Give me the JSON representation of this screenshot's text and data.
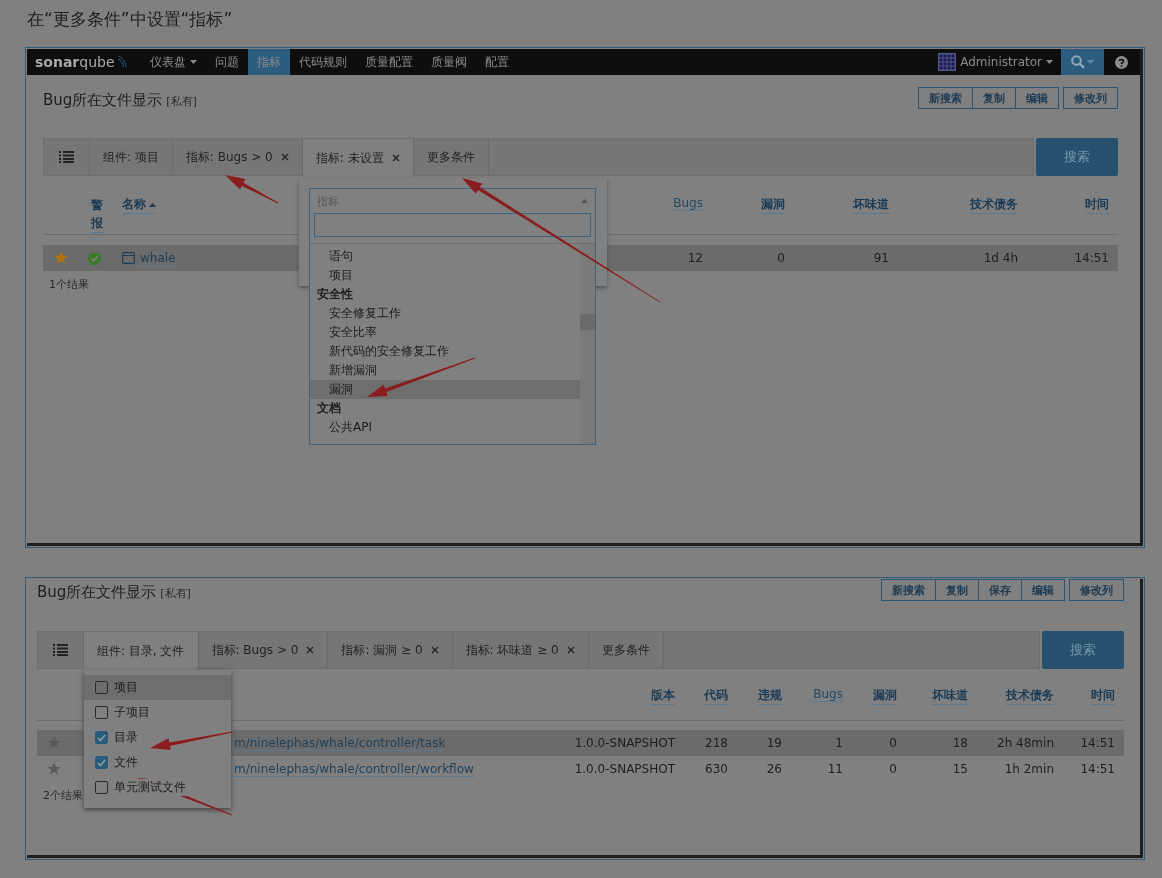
{
  "caption": "在“更多条件”中设置“指标”",
  "shot1": {
    "nav": {
      "logo": "**sonar**qube",
      "items": [
        {
          "label": "仪表盘",
          "dropdown": true,
          "selected": false
        },
        {
          "label": "问题",
          "dropdown": false,
          "selected": false
        },
        {
          "label": "指标",
          "dropdown": false,
          "selected": true
        },
        {
          "label": "代码规则",
          "dropdown": false,
          "selected": false
        },
        {
          "label": "质量配置",
          "dropdown": false,
          "selected": false
        },
        {
          "label": "质量阀",
          "dropdown": false,
          "selected": false
        },
        {
          "label": "配置",
          "dropdown": false,
          "selected": false
        }
      ],
      "user": "Administrator"
    },
    "title": "Bug所在文件显示",
    "visibility": "[私有]",
    "action_groups": [
      [
        "新搜索",
        "复制",
        "编辑"
      ],
      [
        "修改列"
      ]
    ],
    "filters": [
      {
        "label": "组件: 项目",
        "removable": false,
        "selected": false
      },
      {
        "label": "指标: Bugs > 0",
        "removable": true,
        "selected": false
      },
      {
        "label": "指标: 未设置",
        "removable": true,
        "selected": true
      },
      {
        "label": "更多条件",
        "removable": false,
        "selected": false
      }
    ],
    "search_button": "搜索",
    "columns": [
      {
        "label": "警报",
        "highlighted": false
      },
      {
        "label": "名称",
        "sort_ascending": true,
        "highlighted": false
      },
      {
        "label": "Bugs",
        "highlighted": true
      },
      {
        "label": "漏洞",
        "highlighted": false
      },
      {
        "label": "坏味道",
        "highlighted": false
      },
      {
        "label": "技术债务",
        "highlighted": false
      },
      {
        "label": "时间",
        "highlighted": false
      }
    ],
    "rows": [
      {
        "favorite": true,
        "alert_ok": true,
        "selected": true,
        "cells": [
          "",
          "whale",
          "12",
          "0",
          "91",
          "1d 4h",
          "14:51"
        ]
      }
    ],
    "result_count": "1个结果",
    "metric_select": {
      "placeholder": "指标",
      "options": [
        {
          "kind": "option",
          "label": "语句",
          "selected": false
        },
        {
          "kind": "option",
          "label": "项目",
          "selected": false
        },
        {
          "kind": "group",
          "label": "安全性",
          "selected": false
        },
        {
          "kind": "option",
          "label": "安全修复工作",
          "selected": false
        },
        {
          "kind": "option",
          "label": "安全比率",
          "selected": false
        },
        {
          "kind": "option",
          "label": "新代码的安全修复工作",
          "selected": false
        },
        {
          "kind": "option",
          "label": "新增漏洞",
          "selected": false
        },
        {
          "kind": "option",
          "label": "漏洞",
          "selected": true
        },
        {
          "kind": "group",
          "label": "文档",
          "selected": false
        },
        {
          "kind": "option",
          "label": "公共API",
          "selected": false
        }
      ]
    }
  },
  "shot2": {
    "title": "Bug所在文件显示",
    "visibility": "[私有]",
    "action_groups": [
      [
        "新搜索",
        "复制",
        "保存",
        "编辑"
      ],
      [
        "修改列"
      ]
    ],
    "filters": [
      {
        "label": "组件: 目录, 文件",
        "removable": false,
        "selected": true
      },
      {
        "label": "指标: Bugs > 0",
        "removable": true,
        "selected": false
      },
      {
        "label": "指标: 漏洞 ≥ 0",
        "removable": true,
        "selected": false
      },
      {
        "label": "指标: 坏味道 ≥ 0",
        "removable": true,
        "selected": false
      },
      {
        "label": "更多条件",
        "removable": false,
        "selected": false
      }
    ],
    "search_button": "搜索",
    "columns": [
      {
        "label": "版本",
        "highlighted": false
      },
      {
        "label": "代码",
        "highlighted": false
      },
      {
        "label": "违规",
        "highlighted": false
      },
      {
        "label": "Bugs",
        "highlighted": true
      },
      {
        "label": "漏洞",
        "highlighted": false
      },
      {
        "label": "坏味道",
        "highlighted": false
      },
      {
        "label": "技术债务",
        "highlighted": false
      },
      {
        "label": "时间",
        "highlighted": false
      }
    ],
    "rows": [
      {
        "favorite": false,
        "name": "m/ninelephas/whale/controller/task",
        "selected": true,
        "cells": [
          "1.0.0-SNAPSHOT",
          "218",
          "19",
          "1",
          "0",
          "18",
          "2h 48min",
          "14:51"
        ]
      },
      {
        "favorite": false,
        "name": "m/ninelephas/whale/controller/workflow",
        "selected": false,
        "cells": [
          "1.0.0-SNAPSHOT",
          "630",
          "26",
          "11",
          "0",
          "15",
          "1h 2min",
          "14:51"
        ]
      }
    ],
    "result_count": "2个结果",
    "component_menu": [
      {
        "label": "项目",
        "checked": false,
        "selected": true
      },
      {
        "label": "子项目",
        "checked": false,
        "selected": false
      },
      {
        "label": "目录",
        "checked": true,
        "selected": false
      },
      {
        "label": "文件",
        "checked": true,
        "selected": false
      },
      {
        "label": "单元测试文件",
        "checked": false,
        "selected": false
      }
    ]
  }
}
